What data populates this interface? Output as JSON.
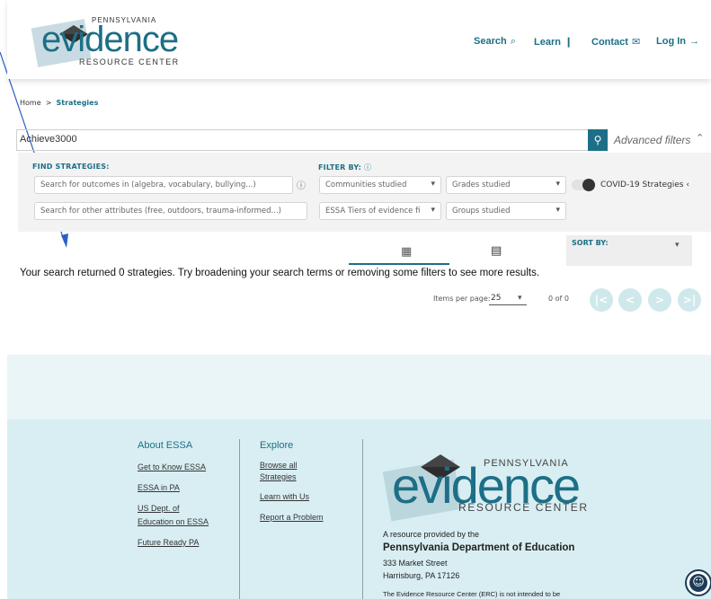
{
  "header": {
    "logo": {
      "top": "PENNSYLVANIA",
      "main": "evidence",
      "sub": "RESOURCE CENTER"
    },
    "nav": [
      {
        "label": "Search",
        "icon": "search-icon",
        "glyph": "⌕"
      },
      {
        "label": "Learn",
        "icon": "books-icon",
        "glyph": "❙"
      },
      {
        "label": "Contact",
        "icon": "mail-icon",
        "glyph": "✉"
      },
      {
        "label": "Log In",
        "icon": "login-icon",
        "glyph": "→"
      }
    ]
  },
  "breadcrumb": {
    "home": "Home",
    "sep": ">",
    "current": "Strategies"
  },
  "search": {
    "value": "Achieve3000",
    "advanced_label": "Advanced filters"
  },
  "filters": {
    "find_label": "FIND STRATEGIES:",
    "filter_label": "FILTER BY:",
    "outcomes_placeholder": "Search for outcomes in (algebra, vocabulary, bullying...)",
    "attributes_placeholder": "Search for other attributes (free, outdoors, trauma-informed...)",
    "communities": "Communities studied",
    "grades": "Grades studied",
    "essa": "ESSA Tiers of evidence fi",
    "groups": "Groups studied",
    "covid": "COVID-19 Strategies"
  },
  "sort": {
    "label": "SORT BY:"
  },
  "results": {
    "message": "Your search returned 0 strategies. Try broadening your search terms or removing some filters to see more results.",
    "items_per_page_label": "Items per page:",
    "items_per_page_value": "25",
    "range": "0 of 0"
  },
  "footer": {
    "col1": {
      "head": "About ESSA",
      "links": [
        "Get to Know ESSA",
        "ESSA in PA",
        "US Dept. of",
        "Education on ESSA",
        "Future Ready PA"
      ]
    },
    "col2": {
      "head": "Explore",
      "links": [
        "Browse all",
        "Strategies",
        "Learn with Us",
        "Report a Problem"
      ]
    },
    "logo": {
      "top": "PENNSYLVANIA",
      "main": "evidence",
      "sub": "RESOURCE CENTER"
    },
    "provided": "A resource provided by the",
    "dept": "Pennsylvania Department of Education",
    "addr1": "333 Market Street",
    "addr2": "Harrisburg, PA 17126",
    "disclaimer": "The Evidence Resource Center (ERC) is not intended to be"
  },
  "colors": {
    "brand": "#1c6f86",
    "footer_bg": "#d8eef2",
    "annotation_arrow": "#2b5fc7"
  }
}
